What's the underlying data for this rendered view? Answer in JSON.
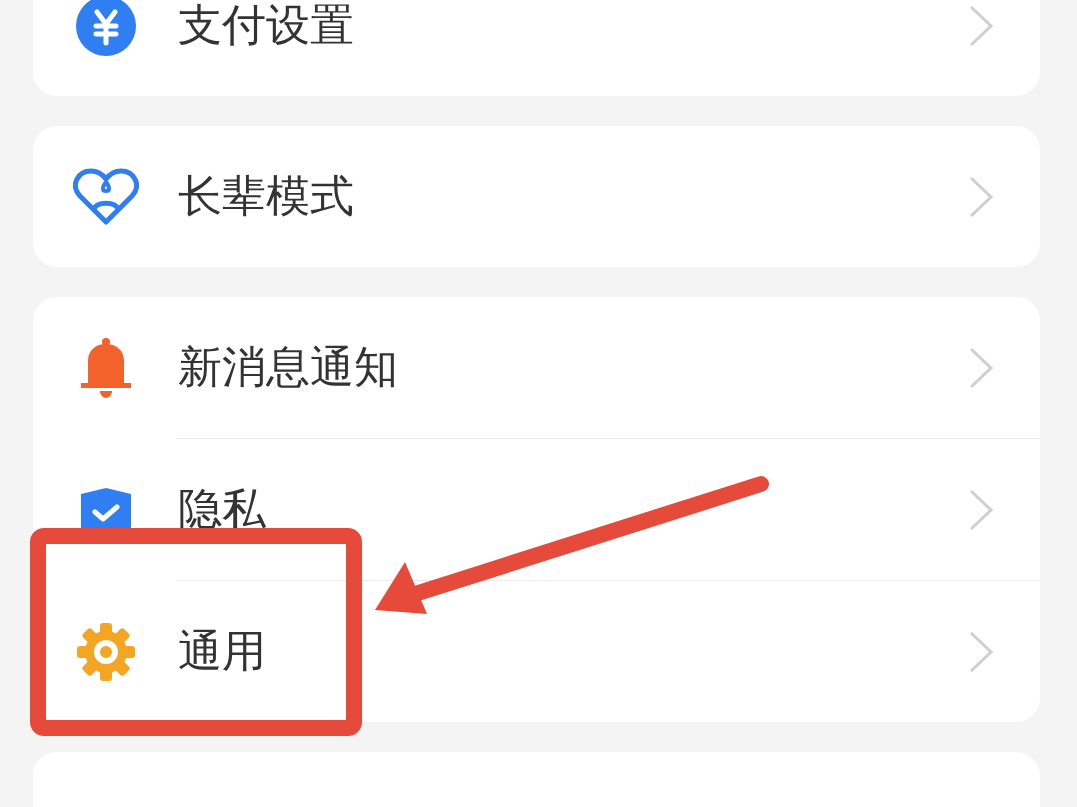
{
  "groups": [
    {
      "items": [
        {
          "label": "支付设置",
          "kind": "yen",
          "highlighted": false
        }
      ]
    },
    {
      "items": [
        {
          "label": "长辈模式",
          "kind": "heart",
          "highlighted": false
        }
      ]
    },
    {
      "items": [
        {
          "label": "新消息通知",
          "kind": "bell",
          "highlighted": false
        },
        {
          "label": "隐私",
          "kind": "shield",
          "highlighted": false
        },
        {
          "label": "通用",
          "kind": "gear",
          "highlighted": true
        }
      ]
    }
  ]
}
